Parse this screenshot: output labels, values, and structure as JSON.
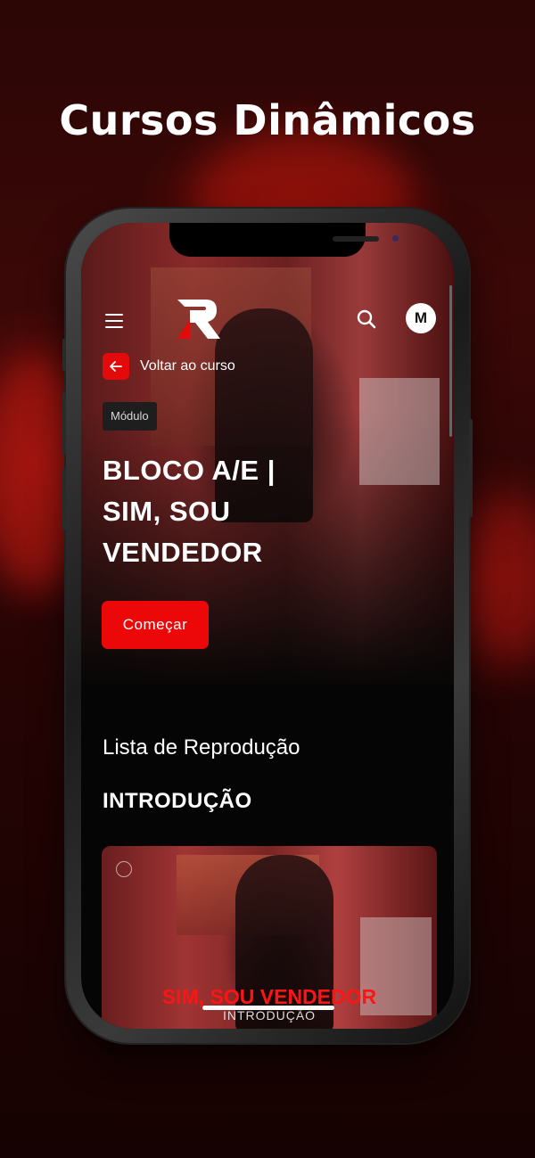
{
  "headline": "Cursos Dinâmicos",
  "header": {
    "menu_icon": "hamburger-menu-icon",
    "logo": "brand-r-logo",
    "search_icon": "search-icon",
    "avatar_initial": "M"
  },
  "navigation": {
    "back_label": "Voltar ao curso",
    "back_icon": "arrow-left-icon"
  },
  "module": {
    "badge": "Módulo",
    "title_lines": [
      "BLOCO A/E |",
      "SIM, SOU",
      "VENDEDOR"
    ],
    "start_label": "Começar"
  },
  "playlist": {
    "label": "Lista de Reprodução",
    "section": "INTRODUÇÃO",
    "items": [
      {
        "title": "SIM, SOU VENDEDOR",
        "subtitle": "INTRODUÇÃO"
      }
    ]
  },
  "colors": {
    "accent": "#ec0808",
    "background": "#050505",
    "backdrop": "#2a0606"
  }
}
